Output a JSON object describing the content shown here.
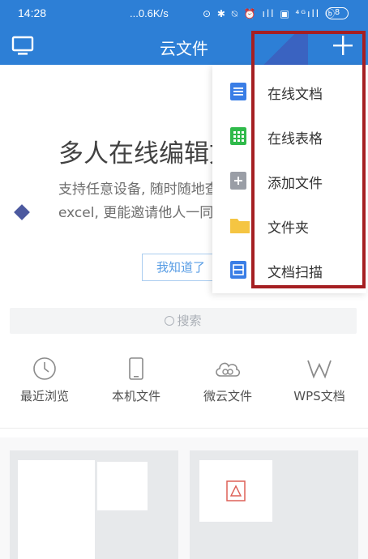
{
  "status_bar": {
    "time": "14:28",
    "network_speed": "...0.6K/s",
    "icons_text": "⊙ ✱ ⍉ ⏰ ıll ▣ ⁴ᴳıll ⓑ",
    "battery": "8"
  },
  "header": {
    "title": "云文件",
    "left_icon": "monitor-icon",
    "right_icon": "plus-icon"
  },
  "guide": {
    "heading": "多人在线编辑文档",
    "description": "支持任意设备, 随时随地查看文档和excel, 更能邀请他人一同编辑。",
    "button": "我知道了"
  },
  "search": {
    "placeholder": "搜索"
  },
  "shortcuts": [
    {
      "label": "最近浏览",
      "icon": "clock-icon"
    },
    {
      "label": "本机文件",
      "icon": "phone-icon"
    },
    {
      "label": "微云文件",
      "icon": "cloud-icon"
    },
    {
      "label": "WPS文档",
      "icon": "wps-icon"
    }
  ],
  "menu": {
    "items": [
      {
        "label": "在线文档",
        "icon": "doc-icon",
        "color": "#3a7ee6"
      },
      {
        "label": "在线表格",
        "icon": "sheet-icon",
        "color": "#2fba4a"
      },
      {
        "label": "添加文件",
        "icon": "add-file-icon",
        "color": "#9a9ea6"
      },
      {
        "label": "文件夹",
        "icon": "folder-icon",
        "color": "#f5c542"
      },
      {
        "label": "文档扫描",
        "icon": "scan-icon",
        "color": "#3a7ee6"
      }
    ]
  },
  "colors": {
    "brand": "#2d7fd6",
    "highlight": "#a51f22"
  }
}
